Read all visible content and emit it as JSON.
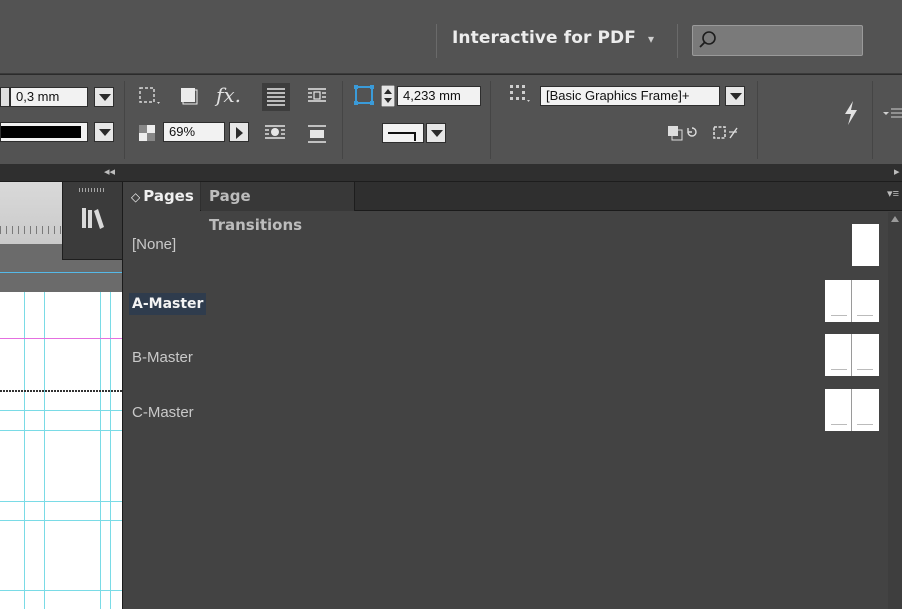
{
  "app_bar": {
    "workspace_label": "Interactive for PDF",
    "workspace_caret": "▾",
    "search_placeholder": ""
  },
  "control_panel": {
    "stroke_weight": "0,3 mm",
    "fill_swatch_color": "#000000",
    "opacity": "69%",
    "offset_value": "4,233 mm",
    "object_style": "[Basic Graphics Frame]+",
    "fx_label": "fx."
  },
  "pages_panel": {
    "tabs": [
      {
        "label": "Pages",
        "active": true
      },
      {
        "label": "Page Transitions",
        "active": false
      }
    ],
    "active_tab_prefix": "◇",
    "masters": [
      {
        "label": "[None]",
        "selected": false,
        "thumb": "single"
      },
      {
        "label": "A-Master",
        "selected": true,
        "thumb": "spread"
      },
      {
        "label": "B-Master",
        "selected": false,
        "thumb": "spread"
      },
      {
        "label": "C-Master",
        "selected": false,
        "thumb": "spread"
      }
    ]
  },
  "icons": {
    "search": "search-icon",
    "library": "library-icon",
    "lightning": "lightning-icon",
    "panel_menu": "panel-menu-icon",
    "collapse": "collapse-arrows-icon"
  },
  "colors": {
    "chrome": "#535353",
    "panel_bg": "#434343",
    "selection": "#2f3c4d",
    "guide_cyan": "#7adbe6",
    "margin_magenta": "#e46fe0"
  }
}
